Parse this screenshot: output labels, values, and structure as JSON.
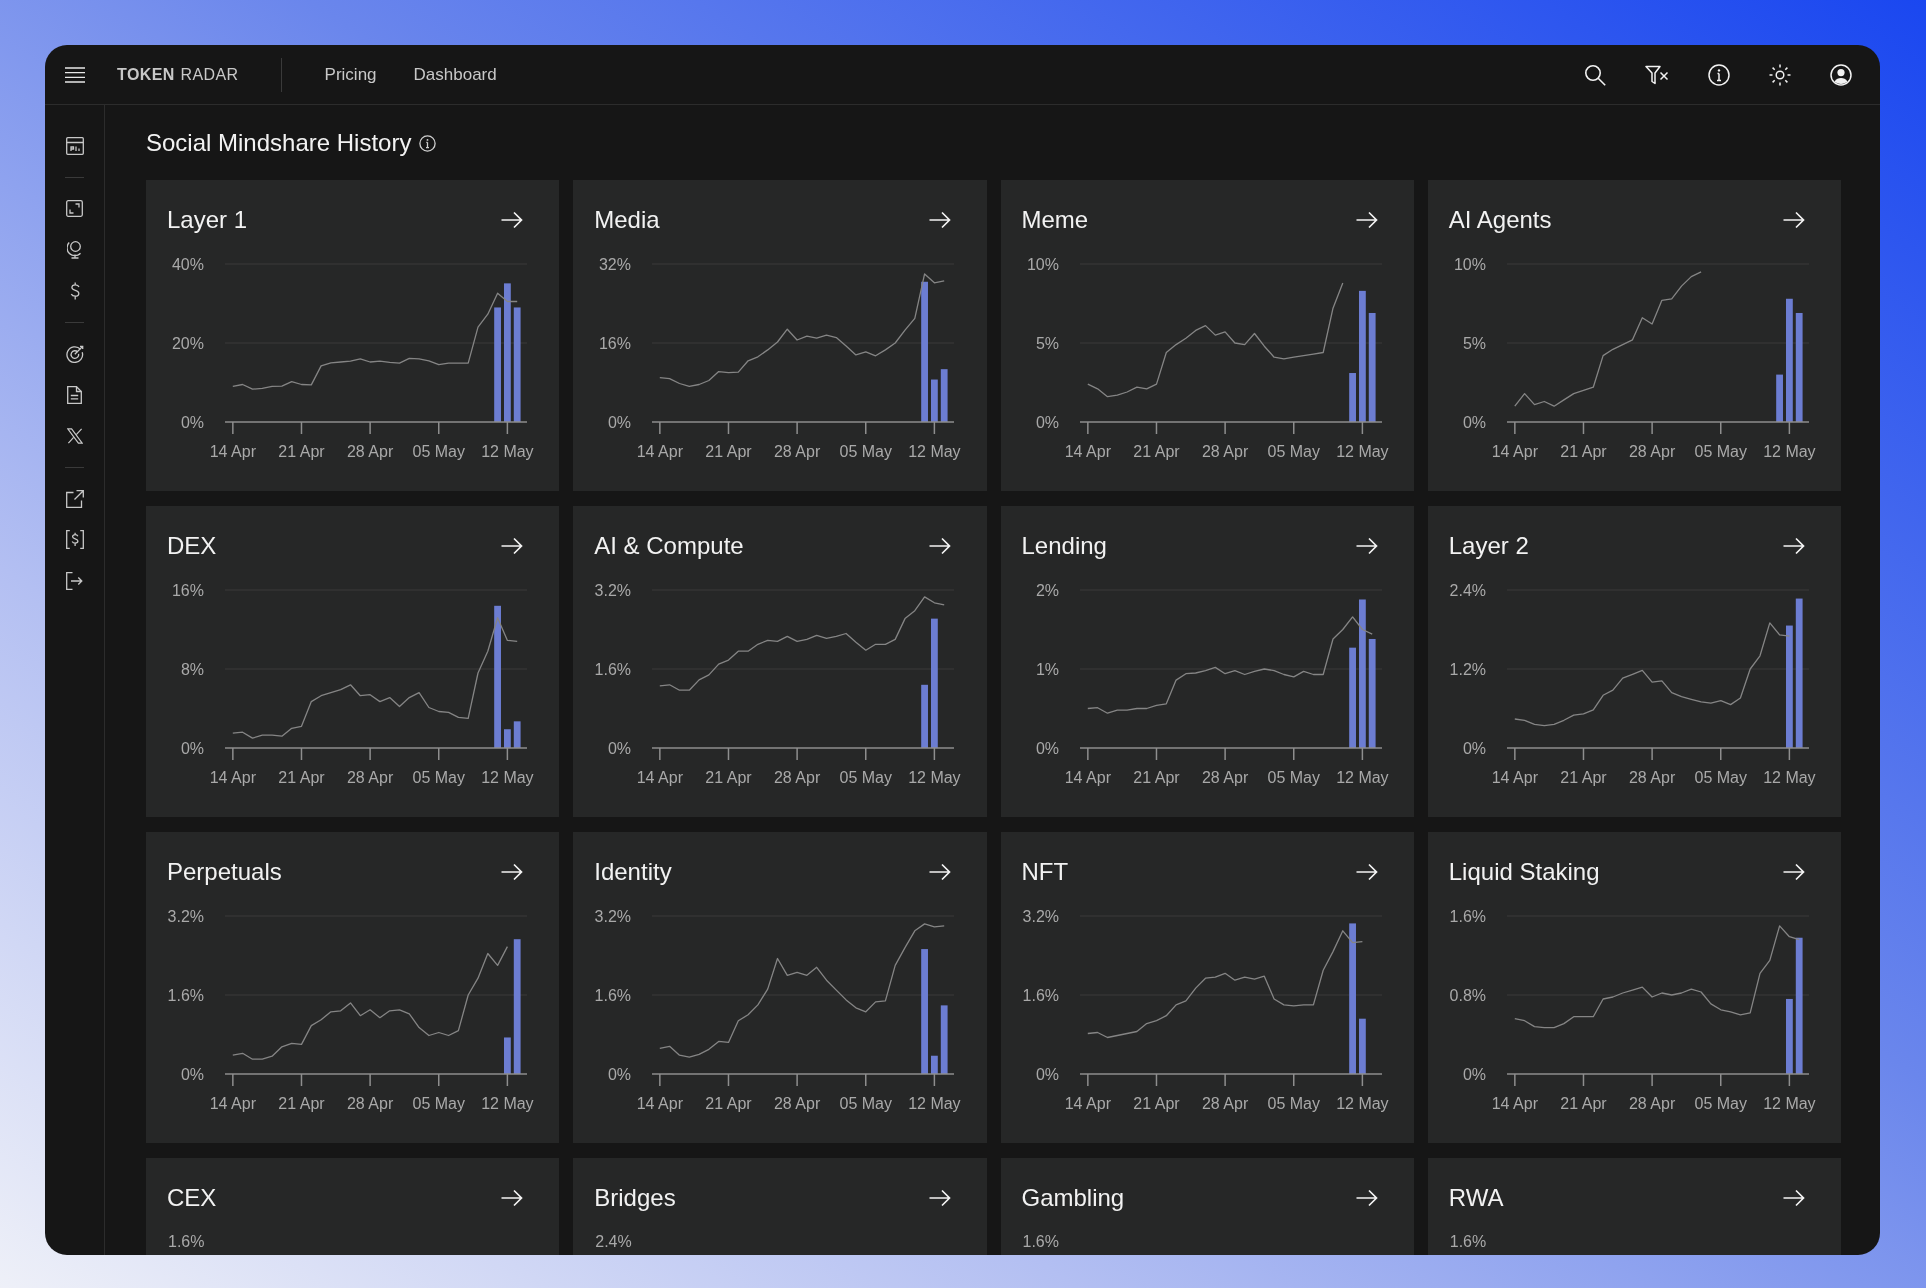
{
  "topbar": {
    "logo": "**TOKEN** RADAR",
    "nav": [
      {
        "label": "Pricing"
      },
      {
        "label": "Dashboard"
      }
    ]
  },
  "heading": "Social Mindshare History",
  "cards": [
    {
      "kind": "chart",
      "title": "Layer 1",
      "chart_data": {
        "type": "line",
        "categories": [
          "14 Apr",
          null,
          null,
          null,
          null,
          null,
          null,
          "21 Apr",
          null,
          null,
          null,
          null,
          null,
          null,
          "28 Apr",
          null,
          null,
          null,
          null,
          null,
          null,
          "05 May",
          null,
          null,
          null,
          null,
          null,
          null,
          "12 May",
          null
        ],
        "ylim": [
          0,
          40
        ],
        "yticks": [
          {
            "value": 0,
            "label": "0%"
          },
          {
            "value": 20,
            "label": "20%"
          },
          {
            "value": 40,
            "label": "40%"
          }
        ],
        "series": [
          {
            "type": "line",
            "color": "#858585",
            "values": [
              9.0,
              9.5,
              8.3,
              8.5,
              9.0,
              9.1,
              10.2,
              9.5,
              9.4,
              14.2,
              15.0,
              15.2,
              15.4,
              16.0,
              15.2,
              15.4,
              15.1,
              14.9,
              16.1,
              16.0,
              15.5,
              14.5,
              14.9,
              14.9,
              14.9,
              24.0,
              27.3,
              32.6,
              30.5,
              30.5
            ]
          },
          {
            "type": "bar",
            "color": "#6c7dd2",
            "values": [
              null,
              null,
              null,
              null,
              null,
              null,
              null,
              null,
              null,
              null,
              null,
              null,
              null,
              null,
              null,
              null,
              null,
              null,
              null,
              null,
              null,
              null,
              null,
              null,
              null,
              null,
              null,
              29.0,
              35.1,
              29.0
            ]
          }
        ]
      }
    },
    {
      "kind": "chart",
      "title": "Media",
      "chart_data": {
        "type": "line",
        "categories": [
          "14 Apr",
          null,
          null,
          null,
          null,
          null,
          null,
          "21 Apr",
          null,
          null,
          null,
          null,
          null,
          null,
          "28 Apr",
          null,
          null,
          null,
          null,
          null,
          null,
          "05 May",
          null,
          null,
          null,
          null,
          null,
          null,
          "12 May",
          null
        ],
        "ylim": [
          0,
          32
        ],
        "yticks": [
          {
            "value": 0,
            "label": "0%"
          },
          {
            "value": 16,
            "label": "16%"
          },
          {
            "value": 32,
            "label": "32%"
          }
        ],
        "series": [
          {
            "type": "line",
            "color": "#858585",
            "values": [
              9.0,
              8.8,
              7.8,
              7.2,
              7.6,
              8.4,
              10.2,
              10.0,
              10.1,
              12.4,
              13.2,
              14.6,
              16.2,
              18.8,
              16.6,
              17.4,
              17.0,
              17.6,
              17.1,
              15.4,
              13.6,
              14.2,
              13.4,
              14.6,
              16.0,
              18.6,
              21.0,
              30.0,
              28.2,
              28.6
            ]
          },
          {
            "type": "bar",
            "color": "#6c7dd2",
            "values": [
              null,
              null,
              null,
              null,
              null,
              null,
              null,
              null,
              null,
              null,
              null,
              null,
              null,
              null,
              null,
              null,
              null,
              null,
              null,
              null,
              null,
              null,
              null,
              null,
              null,
              null,
              null,
              28.4,
              8.6,
              10.7
            ]
          }
        ]
      }
    },
    {
      "kind": "chart",
      "title": "Meme",
      "chart_data": {
        "type": "line",
        "categories": [
          "14 Apr",
          null,
          null,
          null,
          null,
          null,
          null,
          "21 Apr",
          null,
          null,
          null,
          null,
          null,
          null,
          "28 Apr",
          null,
          null,
          null,
          null,
          null,
          null,
          "05 May",
          null,
          null,
          null,
          null,
          null,
          null,
          "12 May",
          null
        ],
        "ylim": [
          0,
          10
        ],
        "yticks": [
          {
            "value": 0,
            "label": "0%"
          },
          {
            "value": 5,
            "label": "5%"
          },
          {
            "value": 10,
            "label": "10%"
          }
        ],
        "series": [
          {
            "type": "line",
            "color": "#858585",
            "values": [
              2.4,
              2.1,
              1.6,
              1.7,
              1.9,
              2.2,
              2.1,
              2.4,
              4.4,
              4.9,
              5.3,
              5.8,
              6.1,
              5.5,
              5.7,
              5.0,
              4.9,
              5.6,
              4.8,
              4.1,
              4.0,
              4.1,
              4.2,
              4.3,
              4.4,
              7.2,
              8.8,
              null,
              null,
              null
            ]
          },
          {
            "type": "bar",
            "color": "#6c7dd2",
            "values": [
              null,
              null,
              null,
              null,
              null,
              null,
              null,
              null,
              null,
              null,
              null,
              null,
              null,
              null,
              null,
              null,
              null,
              null,
              null,
              null,
              null,
              null,
              null,
              null,
              null,
              null,
              null,
              3.1,
              8.3,
              6.9
            ]
          }
        ]
      }
    },
    {
      "kind": "chart",
      "title": "AI Agents",
      "chart_data": {
        "type": "line",
        "categories": [
          "14 Apr",
          null,
          null,
          null,
          null,
          null,
          null,
          "21 Apr",
          null,
          null,
          null,
          null,
          null,
          null,
          "28 Apr",
          null,
          null,
          null,
          null,
          null,
          null,
          "05 May",
          null,
          null,
          null,
          null,
          null,
          null,
          "12 May",
          null
        ],
        "ylim": [
          0,
          10
        ],
        "yticks": [
          {
            "value": 0,
            "label": "0%"
          },
          {
            "value": 5,
            "label": "5%"
          },
          {
            "value": 10,
            "label": "10%"
          }
        ],
        "series": [
          {
            "type": "line",
            "color": "#858585",
            "values": [
              1.0,
              1.8,
              1.1,
              1.3,
              1.0,
              1.4,
              1.8,
              2.0,
              2.2,
              4.2,
              4.6,
              4.9,
              5.2,
              6.6,
              6.2,
              7.7,
              7.8,
              8.6,
              9.2,
              9.5,
              null,
              null,
              null,
              null,
              null,
              null,
              null,
              null,
              null,
              null
            ]
          },
          {
            "type": "bar",
            "color": "#6c7dd2",
            "values": [
              null,
              null,
              null,
              null,
              null,
              null,
              null,
              null,
              null,
              null,
              null,
              null,
              null,
              null,
              null,
              null,
              null,
              null,
              null,
              null,
              null,
              null,
              null,
              null,
              null,
              null,
              null,
              3.0,
              7.8,
              6.9
            ]
          }
        ]
      }
    },
    {
      "kind": "chart",
      "title": "DEX",
      "chart_data": {
        "type": "line",
        "categories": [
          "14 Apr",
          null,
          null,
          null,
          null,
          null,
          null,
          "21 Apr",
          null,
          null,
          null,
          null,
          null,
          null,
          "28 Apr",
          null,
          null,
          null,
          null,
          null,
          null,
          "05 May",
          null,
          null,
          null,
          null,
          null,
          null,
          "12 May",
          null
        ],
        "ylim": [
          0,
          16
        ],
        "yticks": [
          {
            "value": 0,
            "label": "0%"
          },
          {
            "value": 8,
            "label": "8%"
          },
          {
            "value": 16,
            "label": "16%"
          }
        ],
        "series": [
          {
            "type": "line",
            "color": "#858585",
            "values": [
              1.5,
              1.6,
              1.0,
              1.3,
              1.3,
              1.2,
              2.0,
              2.2,
              4.7,
              5.3,
              5.6,
              5.9,
              6.4,
              5.3,
              5.4,
              4.7,
              5.1,
              4.2,
              5.1,
              5.6,
              4.1,
              3.7,
              3.6,
              3.1,
              3.0,
              7.6,
              9.8,
              13.2,
              10.9,
              10.8
            ]
          },
          {
            "type": "bar",
            "color": "#6c7dd2",
            "values": [
              null,
              null,
              null,
              null,
              null,
              null,
              null,
              null,
              null,
              null,
              null,
              null,
              null,
              null,
              null,
              null,
              null,
              null,
              null,
              null,
              null,
              null,
              null,
              null,
              null,
              null,
              null,
              14.4,
              1.9,
              2.7
            ]
          }
        ]
      }
    },
    {
      "kind": "chart",
      "title": "AI & Compute",
      "chart_data": {
        "type": "line",
        "categories": [
          "14 Apr",
          null,
          null,
          null,
          null,
          null,
          null,
          "21 Apr",
          null,
          null,
          null,
          null,
          null,
          null,
          "28 Apr",
          null,
          null,
          null,
          null,
          null,
          null,
          "05 May",
          null,
          null,
          null,
          null,
          null,
          null,
          "12 May",
          null
        ],
        "ylim": [
          0,
          3.2
        ],
        "yticks": [
          {
            "value": 0,
            "label": "0%"
          },
          {
            "value": 1.6,
            "label": "1.6%"
          },
          {
            "value": 3.2,
            "label": "3.2%"
          }
        ],
        "series": [
          {
            "type": "line",
            "color": "#858585",
            "values": [
              1.26,
              1.28,
              1.17,
              1.17,
              1.38,
              1.48,
              1.7,
              1.78,
              1.96,
              1.96,
              2.1,
              2.18,
              2.16,
              2.26,
              2.16,
              2.2,
              2.28,
              2.22,
              2.26,
              2.32,
              2.14,
              1.98,
              2.1,
              2.1,
              2.2,
              2.62,
              2.78,
              3.06,
              2.94,
              2.9
            ]
          },
          {
            "type": "bar",
            "color": "#6c7dd2",
            "values": [
              null,
              null,
              null,
              null,
              null,
              null,
              null,
              null,
              null,
              null,
              null,
              null,
              null,
              null,
              null,
              null,
              null,
              null,
              null,
              null,
              null,
              null,
              null,
              null,
              null,
              null,
              null,
              1.28,
              2.62,
              null
            ]
          }
        ]
      }
    },
    {
      "kind": "chart",
      "title": "Lending",
      "chart_data": {
        "type": "line",
        "categories": [
          "14 Apr",
          null,
          null,
          null,
          null,
          null,
          null,
          "21 Apr",
          null,
          null,
          null,
          null,
          null,
          null,
          "28 Apr",
          null,
          null,
          null,
          null,
          null,
          null,
          "05 May",
          null,
          null,
          null,
          null,
          null,
          null,
          "12 May",
          null
        ],
        "ylim": [
          0,
          2
        ],
        "yticks": [
          {
            "value": 0,
            "label": "0%"
          },
          {
            "value": 1,
            "label": "1%"
          },
          {
            "value": 2,
            "label": "2%"
          }
        ],
        "series": [
          {
            "type": "line",
            "color": "#858585",
            "values": [
              0.5,
              0.51,
              0.44,
              0.48,
              0.48,
              0.5,
              0.5,
              0.54,
              0.56,
              0.86,
              0.94,
              0.95,
              0.98,
              1.02,
              0.94,
              0.98,
              0.93,
              0.97,
              1.0,
              0.98,
              0.93,
              0.9,
              0.97,
              0.93,
              0.93,
              1.38,
              1.5,
              1.66,
              1.5,
              1.44
            ]
          },
          {
            "type": "bar",
            "color": "#6c7dd2",
            "values": [
              null,
              null,
              null,
              null,
              null,
              null,
              null,
              null,
              null,
              null,
              null,
              null,
              null,
              null,
              null,
              null,
              null,
              null,
              null,
              null,
              null,
              null,
              null,
              null,
              null,
              null,
              null,
              1.27,
              1.88,
              1.38
            ]
          }
        ]
      }
    },
    {
      "kind": "chart",
      "title": "Layer 2",
      "chart_data": {
        "type": "line",
        "categories": [
          "14 Apr",
          null,
          null,
          null,
          null,
          null,
          null,
          "21 Apr",
          null,
          null,
          null,
          null,
          null,
          null,
          "28 Apr",
          null,
          null,
          null,
          null,
          null,
          null,
          "05 May",
          null,
          null,
          null,
          null,
          null,
          null,
          "12 May",
          null
        ],
        "ylim": [
          0,
          2.4
        ],
        "yticks": [
          {
            "value": 0,
            "label": "0%"
          },
          {
            "value": 1.2,
            "label": "1.2%"
          },
          {
            "value": 2.4,
            "label": "2.4%"
          }
        ],
        "series": [
          {
            "type": "line",
            "color": "#858585",
            "values": [
              0.44,
              0.42,
              0.36,
              0.34,
              0.36,
              0.42,
              0.5,
              0.52,
              0.58,
              0.8,
              0.88,
              1.06,
              1.12,
              1.18,
              1.0,
              1.02,
              0.84,
              0.78,
              0.74,
              0.7,
              0.68,
              0.72,
              0.66,
              0.76,
              1.2,
              1.4,
              1.9,
              1.72,
              1.7,
              null
            ]
          },
          {
            "type": "bar",
            "color": "#6c7dd2",
            "values": [
              null,
              null,
              null,
              null,
              null,
              null,
              null,
              null,
              null,
              null,
              null,
              null,
              null,
              null,
              null,
              null,
              null,
              null,
              null,
              null,
              null,
              null,
              null,
              null,
              null,
              null,
              null,
              null,
              1.86,
              2.27
            ]
          }
        ]
      }
    },
    {
      "kind": "chart",
      "title": "Perpetuals",
      "chart_data": {
        "type": "line",
        "categories": [
          "14 Apr",
          null,
          null,
          null,
          null,
          null,
          null,
          "21 Apr",
          null,
          null,
          null,
          null,
          null,
          null,
          "28 Apr",
          null,
          null,
          null,
          null,
          null,
          null,
          "05 May",
          null,
          null,
          null,
          null,
          null,
          null,
          "12 May",
          null
        ],
        "ylim": [
          0,
          3.2
        ],
        "yticks": [
          {
            "value": 0,
            "label": "0%"
          },
          {
            "value": 1.6,
            "label": "1.6%"
          },
          {
            "value": 3.2,
            "label": "3.2%"
          }
        ],
        "series": [
          {
            "type": "line",
            "color": "#858585",
            "values": [
              0.38,
              0.42,
              0.3,
              0.3,
              0.36,
              0.55,
              0.62,
              0.6,
              0.98,
              1.1,
              1.26,
              1.28,
              1.44,
              1.18,
              1.3,
              1.14,
              1.28,
              1.3,
              1.22,
              0.94,
              0.78,
              0.84,
              0.78,
              0.88,
              1.6,
              1.94,
              2.44,
              2.2,
              2.58,
              null
            ]
          },
          {
            "type": "bar",
            "color": "#6c7dd2",
            "values": [
              null,
              null,
              null,
              null,
              null,
              null,
              null,
              null,
              null,
              null,
              null,
              null,
              null,
              null,
              null,
              null,
              null,
              null,
              null,
              null,
              null,
              null,
              null,
              null,
              null,
              null,
              null,
              null,
              0.74,
              2.73
            ]
          }
        ]
      }
    },
    {
      "kind": "chart",
      "title": "Identity",
      "chart_data": {
        "type": "line",
        "categories": [
          "14 Apr",
          null,
          null,
          null,
          null,
          null,
          null,
          "21 Apr",
          null,
          null,
          null,
          null,
          null,
          null,
          "28 Apr",
          null,
          null,
          null,
          null,
          null,
          null,
          "05 May",
          null,
          null,
          null,
          null,
          null,
          null,
          "12 May",
          null
        ],
        "ylim": [
          0,
          3.2
        ],
        "yticks": [
          {
            "value": 0,
            "label": "0%"
          },
          {
            "value": 1.6,
            "label": "1.6%"
          },
          {
            "value": 3.2,
            "label": "3.2%"
          }
        ],
        "series": [
          {
            "type": "line",
            "color": "#858585",
            "values": [
              0.52,
              0.56,
              0.38,
              0.34,
              0.4,
              0.5,
              0.66,
              0.64,
              1.08,
              1.2,
              1.4,
              1.72,
              2.34,
              2.0,
              2.06,
              2.0,
              2.16,
              1.9,
              1.7,
              1.5,
              1.34,
              1.26,
              1.46,
              1.48,
              2.2,
              2.56,
              2.9,
              3.04,
              2.98,
              3.0
            ]
          },
          {
            "type": "bar",
            "color": "#6c7dd2",
            "values": [
              null,
              null,
              null,
              null,
              null,
              null,
              null,
              null,
              null,
              null,
              null,
              null,
              null,
              null,
              null,
              null,
              null,
              null,
              null,
              null,
              null,
              null,
              null,
              null,
              null,
              null,
              null,
              2.53,
              0.37,
              1.39
            ]
          }
        ]
      }
    },
    {
      "kind": "chart",
      "title": "NFT",
      "chart_data": {
        "type": "line",
        "categories": [
          "14 Apr",
          null,
          null,
          null,
          null,
          null,
          null,
          "21 Apr",
          null,
          null,
          null,
          null,
          null,
          null,
          "28 Apr",
          null,
          null,
          null,
          null,
          null,
          null,
          "05 May",
          null,
          null,
          null,
          null,
          null,
          null,
          "12 May",
          null
        ],
        "ylim": [
          0,
          3.2
        ],
        "yticks": [
          {
            "value": 0,
            "label": "0%"
          },
          {
            "value": 1.6,
            "label": "1.6%"
          },
          {
            "value": 3.2,
            "label": "3.2%"
          }
        ],
        "series": [
          {
            "type": "line",
            "color": "#858585",
            "values": [
              0.82,
              0.84,
              0.74,
              0.78,
              0.82,
              0.86,
              1.02,
              1.08,
              1.18,
              1.4,
              1.48,
              1.74,
              1.94,
              1.96,
              2.04,
              1.9,
              1.96,
              1.92,
              1.98,
              1.52,
              1.4,
              1.38,
              1.4,
              1.4,
              2.1,
              2.48,
              2.9,
              2.66,
              2.68,
              null
            ]
          },
          {
            "type": "bar",
            "color": "#6c7dd2",
            "values": [
              null,
              null,
              null,
              null,
              null,
              null,
              null,
              null,
              null,
              null,
              null,
              null,
              null,
              null,
              null,
              null,
              null,
              null,
              null,
              null,
              null,
              null,
              null,
              null,
              null,
              null,
              null,
              3.05,
              1.12,
              null
            ]
          }
        ]
      }
    },
    {
      "kind": "chart",
      "title": "Liquid Staking",
      "chart_data": {
        "type": "line",
        "categories": [
          "14 Apr",
          null,
          null,
          null,
          null,
          null,
          null,
          "21 Apr",
          null,
          null,
          null,
          null,
          null,
          null,
          "28 Apr",
          null,
          null,
          null,
          null,
          null,
          null,
          "05 May",
          null,
          null,
          null,
          null,
          null,
          null,
          "12 May",
          null
        ],
        "ylim": [
          0,
          1.6
        ],
        "yticks": [
          {
            "value": 0,
            "label": "0%"
          },
          {
            "value": 0.8,
            "label": "0.8%"
          },
          {
            "value": 1.6,
            "label": "1.6%"
          }
        ],
        "series": [
          {
            "type": "line",
            "color": "#858585",
            "values": [
              0.56,
              0.54,
              0.48,
              0.47,
              0.47,
              0.51,
              0.58,
              0.58,
              0.58,
              0.76,
              0.78,
              0.82,
              0.85,
              0.88,
              0.78,
              0.82,
              0.8,
              0.82,
              0.86,
              0.83,
              0.71,
              0.65,
              0.63,
              0.6,
              0.62,
              1.02,
              1.15,
              1.5,
              1.39,
              1.36
            ]
          },
          {
            "type": "bar",
            "color": "#6c7dd2",
            "values": [
              null,
              null,
              null,
              null,
              null,
              null,
              null,
              null,
              null,
              null,
              null,
              null,
              null,
              null,
              null,
              null,
              null,
              null,
              null,
              null,
              null,
              null,
              null,
              null,
              null,
              null,
              null,
              null,
              0.76,
              1.38
            ]
          }
        ]
      }
    },
    {
      "kind": "partial",
      "title": "CEX",
      "tick_label": "1.6%"
    },
    {
      "kind": "partial",
      "title": "Bridges",
      "tick_label": "2.4%"
    },
    {
      "kind": "partial",
      "title": "Gambling",
      "tick_label": "1.6%"
    },
    {
      "kind": "partial",
      "title": "RWA",
      "tick_label": "1.6%"
    }
  ]
}
